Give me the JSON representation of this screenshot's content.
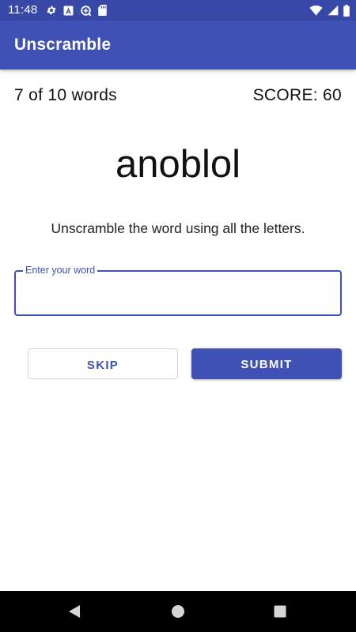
{
  "status_bar": {
    "time": "11:48",
    "left_icons": [
      "gear-icon",
      "a-badge-icon",
      "data-saver-icon",
      "sd-card-icon"
    ],
    "right_icons": [
      "wifi-icon",
      "cell-signal-icon",
      "battery-icon"
    ]
  },
  "app_bar": {
    "title": "Unscramble"
  },
  "game": {
    "word_count": "7 of 10 words",
    "score": "SCORE: 60",
    "scrambled_word": "anoblol",
    "instructions": "Unscramble the word using all the letters."
  },
  "input": {
    "label": "Enter your word",
    "value": ""
  },
  "buttons": {
    "skip": "SKIP",
    "submit": "SUBMIT"
  },
  "nav_bar": {
    "icons": [
      "back-icon",
      "home-icon",
      "recents-icon"
    ]
  },
  "colors": {
    "primary": "#3f51b5",
    "primary_dark": "#3748a6",
    "on_primary": "#ffffff",
    "nav_bar": "#000000"
  }
}
